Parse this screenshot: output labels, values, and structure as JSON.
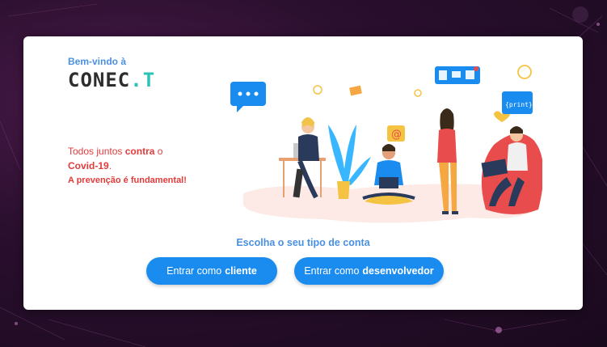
{
  "header": {
    "welcome": "Bem-vindo à",
    "brand_main": "CONEC",
    "brand_dot": ".",
    "brand_t": "T"
  },
  "message": {
    "line1_prefix": "Todos juntos",
    "line1_bold": "contra",
    "line1_suffix": "o",
    "line2_bold": "Covid-19",
    "line2_suffix": ".",
    "line3": "A prevenção é fundamental!"
  },
  "illustration": {
    "bubble_text": "{print};"
  },
  "choose": {
    "label": "Escolha o seu tipo de conta"
  },
  "buttons": {
    "client_prefix": "Entrar como",
    "client_bold": "cliente",
    "dev_prefix": "Entrar como",
    "dev_bold": "desenvolvedor"
  },
  "colors": {
    "accent": "#1a8cf0",
    "brand_teal": "#2bc3b5",
    "warning_red": "#e23b3b",
    "title_blue": "#4a90e2"
  }
}
